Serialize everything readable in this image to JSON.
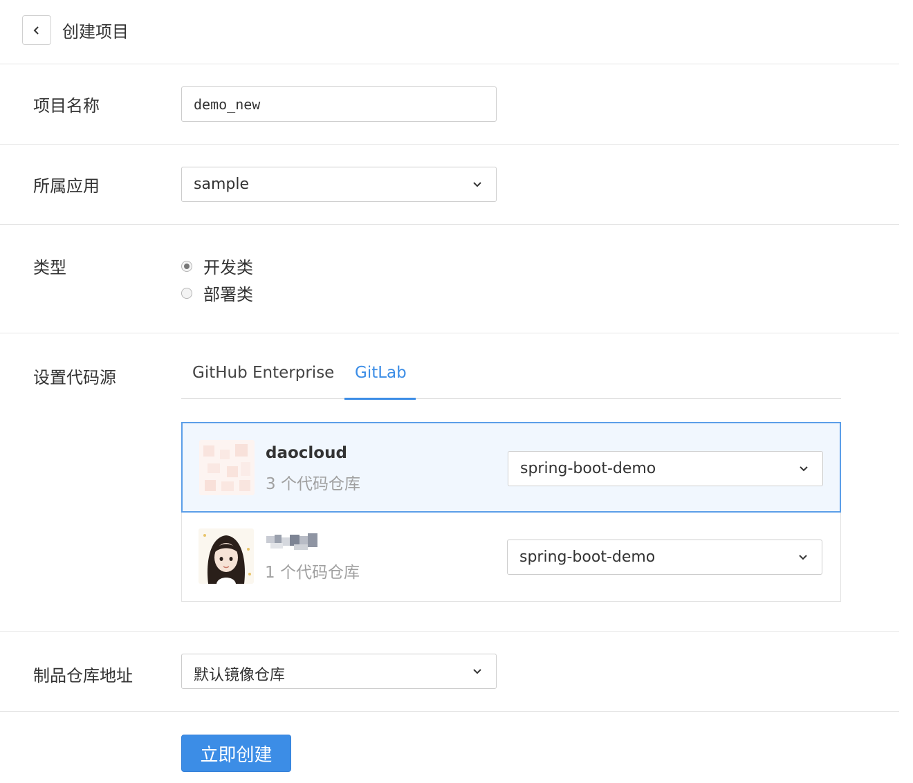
{
  "header": {
    "title": "创建项目"
  },
  "form": {
    "project_name": {
      "label": "项目名称",
      "value": "demo_new"
    },
    "application": {
      "label": "所属应用",
      "selected": "sample"
    },
    "type": {
      "label": "类型",
      "options": [
        {
          "label": "开发类",
          "checked": true
        },
        {
          "label": "部署类",
          "checked": false
        }
      ]
    },
    "code_source": {
      "label": "设置代码源",
      "tabs": [
        {
          "label": "GitHub Enterprise",
          "active": false
        },
        {
          "label": "GitLab",
          "active": true
        }
      ],
      "orgs": [
        {
          "name": "daocloud",
          "repo_count": "3 个代码仓库",
          "selected_repo": "spring-boot-demo",
          "selected": true
        },
        {
          "name": "",
          "repo_count": "1 个代码仓库",
          "selected_repo": "spring-boot-demo",
          "selected": false
        }
      ]
    },
    "artifact_repo": {
      "label": "制品仓库地址",
      "selected": "默认镜像仓库"
    }
  },
  "actions": {
    "create_label": "立即创建"
  },
  "colors": {
    "accent": "#3c8de6",
    "selected_bg": "#f1f7fe",
    "muted_text": "#a0a0a0"
  }
}
